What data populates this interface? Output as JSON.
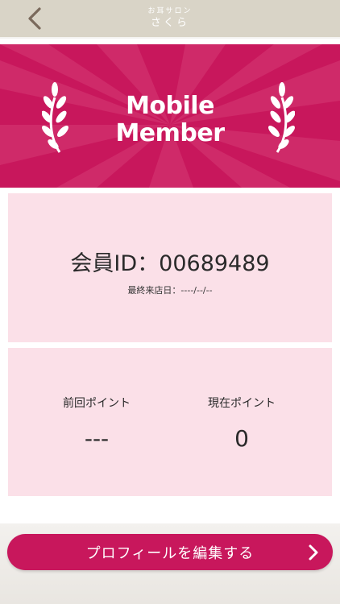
{
  "header": {
    "subtitle": "お耳サロン",
    "title": "さくら"
  },
  "banner": {
    "line1": "Mobile",
    "line2": "Member"
  },
  "member": {
    "id_label": "会員ID：00689489",
    "last_visit": "最終来店日：----/--/--"
  },
  "points": {
    "previous_label": "前回ポイント",
    "previous_value": "---",
    "current_label": "現在ポイント",
    "current_value": "0"
  },
  "actions": {
    "edit_profile_label": "プロフィールを編集する"
  },
  "colors": {
    "accent": "#c8175c",
    "card": "#fbe0e8",
    "header": "#d9d4c7"
  }
}
